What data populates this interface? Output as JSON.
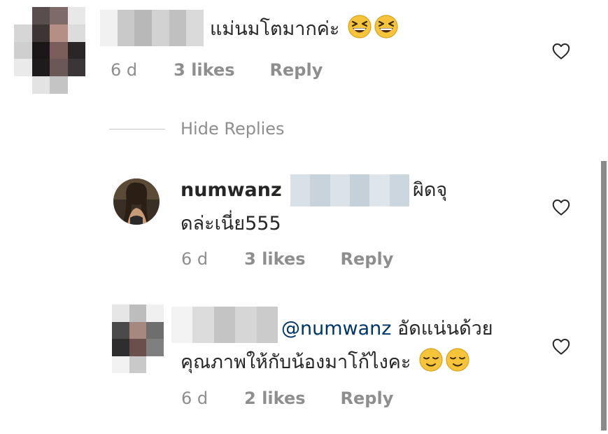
{
  "comments": [
    {
      "text": "แม่นมโตมากค่ะ",
      "age": "6 d",
      "likes": "3 likes",
      "reply_label": "Reply"
    }
  ],
  "toggle_replies_label": "Hide Replies",
  "replies": [
    {
      "username": "numwanz",
      "text_line1": "ผิดจุ",
      "text_line2": "ดล่ะเนี่ย555",
      "age": "6 d",
      "likes": "3 likes",
      "reply_label": "Reply"
    },
    {
      "mention": "@numwanz",
      "text_line1": "อัดแน่นด้วย",
      "text_line2": "คุณภาพให้กับน้องมาโก้ไงคะ",
      "age": "6 d",
      "likes": "2 likes",
      "reply_label": "Reply"
    }
  ],
  "icons": {
    "like": "heart-icon",
    "laugh_emoji": "grinning-squinting-face-emoji",
    "relieved_emoji": "relieved-face-emoji"
  },
  "colors": {
    "text": "#262626",
    "meta": "#8e8e8e",
    "mention": "#003569",
    "emoji": "#f6c43b"
  }
}
